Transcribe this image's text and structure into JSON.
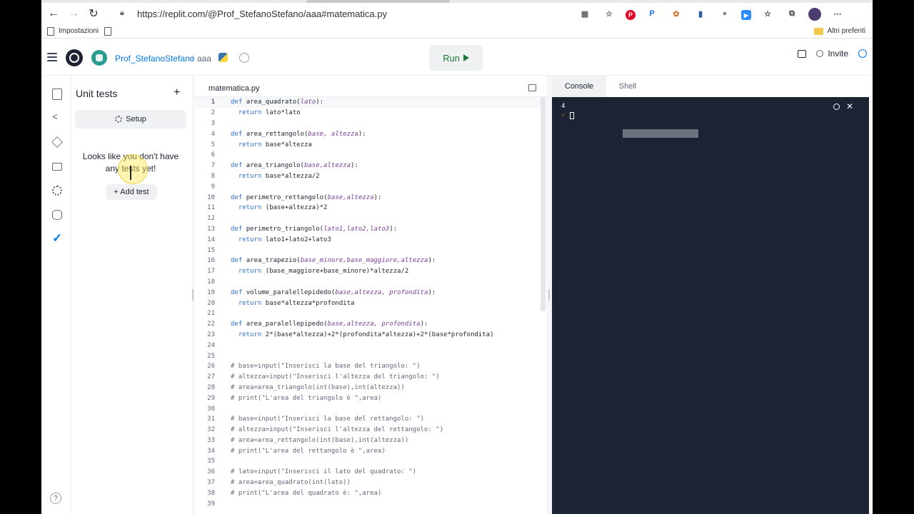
{
  "browser": {
    "url": "https://replit.com/@Prof_StefanoStefano/aaa#matematica.py",
    "bookmarks": [
      "Impostazioni"
    ],
    "other_bookmarks": "Altri preferiti",
    "ext_p": "P"
  },
  "header": {
    "owner": "Prof_StefanoStefano",
    "separator": "/",
    "repl_name": "aaa",
    "run_label": "Run",
    "invite_label": "Invite"
  },
  "unit_tests": {
    "title": "Unit tests",
    "setup_label": "Setup",
    "empty_text": "Looks like you don't have any tests yet!",
    "add_test_label": "+ Add test"
  },
  "editor": {
    "filename": "matematica.py",
    "active_line": 1,
    "lines": [
      "def area_quadrato(lato):",
      "  return lato*lato",
      "",
      "def area_rettangolo(base, altezza):",
      "  return base*altezza",
      "",
      "def area_triangolo(base,altezza):",
      "  return base*altezza/2",
      "",
      "def perimetro_rettangolo(base,altezza):",
      "  return (base+altezza)*2",
      "",
      "def perimetro_triangolo(lato1,lato2,lato3):",
      "  return lato1+lato2+lato3",
      "",
      "def area_trapezio(base_minore,base_maggiore,altezza):",
      "  return (base_maggiore+base_minore)*altezza/2",
      "",
      "def volume_paralellepidedo(base,altezza, profondita):",
      "  return base*altezza*profondita",
      "",
      "def area_paralellepipedo(base,altezza, profondita):",
      "  return 2*(base*altezza)+2*(profondita*altezza)+2*(base*profondita)",
      "",
      "",
      "# base=input(\"Inserisci la base del triangolo: \")",
      "# altezza=input(\"Inserisci l'altezza del triangolo: \")",
      "# area=area_triangolo(int(base),int(altezza))",
      "# print(\"L'area del triangolo è \",area)",
      "",
      "# base=input(\"Inserisci la base del rettangolo: \")",
      "# altezza=input(\"Inserisci l'altezza del rettangolo: \")",
      "# area=area_rettangolo(int(base),int(altezza))",
      "# print(\"L'area del rettangolo è \",area)",
      "",
      "# lato=input(\"Inserisci il lato del quadrato: \")",
      "# area=area_quadrato(int(lato))",
      "# print(\"L'area del quadrato è: \",area)",
      ""
    ]
  },
  "console": {
    "tabs": [
      "Console",
      "Shell"
    ],
    "output": "4",
    "prompt": "›"
  },
  "help_label": "?"
}
